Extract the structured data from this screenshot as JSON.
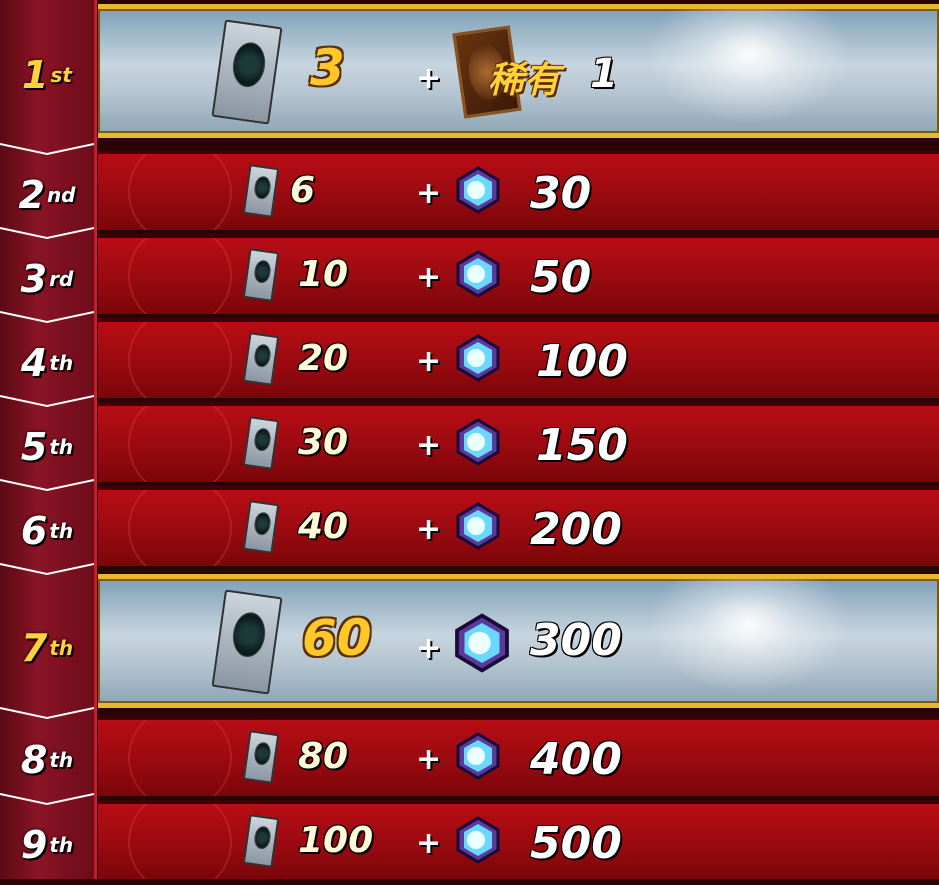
{
  "ranks": [
    {
      "num": "1",
      "suffix": "st",
      "highlight": true
    },
    {
      "num": "2",
      "suffix": "nd",
      "highlight": false
    },
    {
      "num": "3",
      "suffix": "rd",
      "highlight": false
    },
    {
      "num": "4",
      "suffix": "th",
      "highlight": false
    },
    {
      "num": "5",
      "suffix": "th",
      "highlight": false
    },
    {
      "num": "6",
      "suffix": "th",
      "highlight": false
    },
    {
      "num": "7",
      "suffix": "th",
      "highlight": true
    },
    {
      "num": "8",
      "suffix": "th",
      "highlight": false
    },
    {
      "num": "9",
      "suffix": "th",
      "highlight": false
    }
  ],
  "rewards": [
    {
      "packs": "3",
      "plus": "+",
      "bonus_label": "稀有",
      "bonus_qty": "1",
      "bonus_icon": "card-back-icon"
    },
    {
      "packs": "6",
      "plus": "+",
      "gems": "30",
      "bonus_icon": "gem-icon"
    },
    {
      "packs": "10",
      "plus": "+",
      "gems": "50",
      "bonus_icon": "gem-icon"
    },
    {
      "packs": "20",
      "plus": "+",
      "gems": "100",
      "bonus_icon": "gem-icon"
    },
    {
      "packs": "30",
      "plus": "+",
      "gems": "150",
      "bonus_icon": "gem-icon"
    },
    {
      "packs": "40",
      "plus": "+",
      "gems": "200",
      "bonus_icon": "gem-icon"
    },
    {
      "packs": "60",
      "plus": "+",
      "gems": "300",
      "bonus_icon": "gem-icon"
    },
    {
      "packs": "80",
      "plus": "+",
      "gems": "400",
      "bonus_icon": "gem-icon"
    },
    {
      "packs": "100",
      "plus": "+",
      "gems": "500",
      "bonus_icon": "gem-icon"
    }
  ],
  "colors": {
    "accent_gold": "#ffd23a",
    "row_red": "#b80d14",
    "row_silver": "#c7d5df",
    "border_gold": "#e6b92e"
  }
}
